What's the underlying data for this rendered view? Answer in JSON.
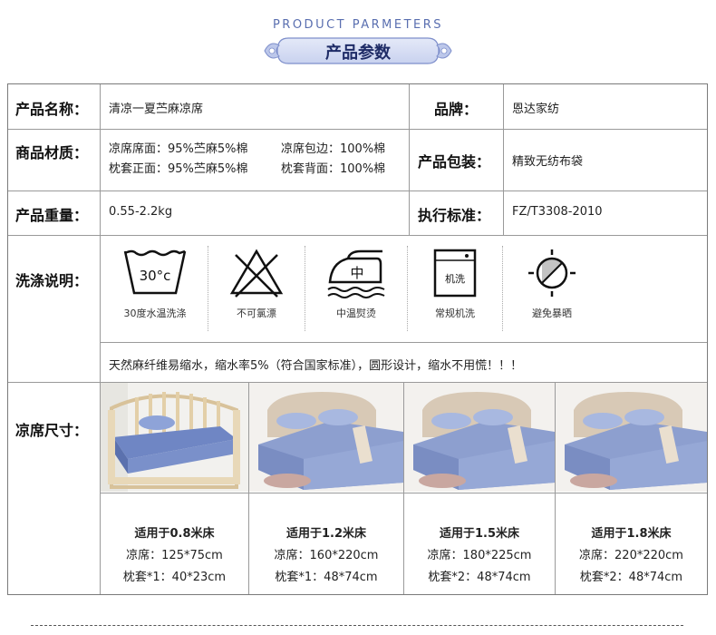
{
  "header": {
    "subtitle_en": "PRODUCT  PARMETERS",
    "title": "产品参数"
  },
  "rows": {
    "name": {
      "label": "产品名称：",
      "value": "清凉一夏苎麻凉席"
    },
    "brand": {
      "label": "品牌：",
      "value": "恩达家纺"
    },
    "material": {
      "label": "商品材质：",
      "line1a": "凉席席面：95%苎麻5%棉",
      "line1b": "凉席包边：100%棉",
      "line2a": "枕套正面：95%苎麻5%棉",
      "line2b": "枕套背面：100%棉"
    },
    "packaging": {
      "label": "产品包装：",
      "value": "精致无纺布袋"
    },
    "weight": {
      "label": "产品重量：",
      "value": "0.55-2.2kg"
    },
    "standard": {
      "label": "执行标准：",
      "value": "FZ/T3308-2010"
    },
    "washing": {
      "label": "洗涤说明：",
      "icons": [
        {
          "icon": "wash-30-icon",
          "text": "30°c",
          "caption": "30度水温洗涤"
        },
        {
          "icon": "no-bleach-icon",
          "caption": "不可氯漂"
        },
        {
          "icon": "iron-medium-icon",
          "text": "中",
          "caption": "中温熨烫"
        },
        {
          "icon": "machine-wash-icon",
          "text": "机洗",
          "caption": "常规机洗"
        },
        {
          "icon": "no-sun-icon",
          "caption": "避免暴晒"
        }
      ],
      "note": "天然麻纤维易缩水，缩水率5%（符合国家标准），圆形设计，缩水不用慌！！！"
    },
    "sizes": {
      "label": "凉席尺寸：",
      "items": [
        {
          "title": "适用于0.8米床",
          "mat": "凉席：125*75cm",
          "pillow": "枕套*1：40*23cm"
        },
        {
          "title": "适用于1.2米床",
          "mat": "凉席：160*220cm",
          "pillow": "枕套*1：48*74cm"
        },
        {
          "title": "适用于1.5米床",
          "mat": "凉席：180*225cm",
          "pillow": "枕套*2：48*74cm"
        },
        {
          "title": "适用于1.8米床",
          "mat": "凉席：220*220cm",
          "pillow": "枕套*2：48*74cm"
        }
      ]
    }
  },
  "colors": {
    "accent": "#5a6fb0",
    "title": "#1e2b66",
    "border": "#9a9a9a"
  }
}
